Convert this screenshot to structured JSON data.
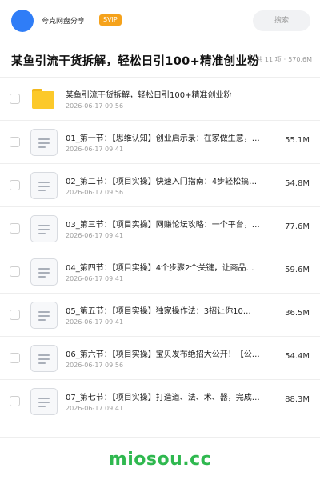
{
  "header": {
    "user_name": "夸克网盘分享",
    "badge": "SVIP",
    "search_placeholder": "搜索",
    "avatar_color": "#2f7df7",
    "badge_color": "#f5a21b"
  },
  "folder": {
    "title": "某鱼引流干货拆解，轻松日引100+精准创业粉",
    "meta_count": "共 11 项",
    "meta_separator": "·",
    "meta_size": "570.6M"
  },
  "items": [
    {
      "type": "folder",
      "icon": "folder-icon",
      "name": "某鱼引流干货拆解，轻松日引100+精准创业粉",
      "date": "2026-06-17 09:56",
      "size": ""
    },
    {
      "type": "file",
      "icon": "document-icon",
      "name": "01_第一节：【思维认知】创业启示录：在家做生意，…",
      "date": "2026-06-17 09:41",
      "size": "55.1M"
    },
    {
      "type": "file",
      "icon": "document-icon",
      "name": "02_第二节：【项目实操】快速入门指南：4步轻松搞…",
      "date": "2026-06-17 09:56",
      "size": "54.8M"
    },
    {
      "type": "file",
      "icon": "document-icon",
      "name": "03_第三节：【项目实操】网赚论坛攻略：一个平台，…",
      "date": "2026-06-17 09:41",
      "size": "77.6M"
    },
    {
      "type": "file",
      "icon": "document-icon",
      "name": "04_第四节：【项目实操】4个步骤2个关键，让商品…",
      "date": "2026-06-17 09:41",
      "size": "59.6M"
    },
    {
      "type": "file",
      "icon": "document-icon",
      "name": "05_第五节：【项目实操】独家操作法：3招让你10…",
      "date": "2026-06-17 09:41",
      "size": "36.5M"
    },
    {
      "type": "file",
      "icon": "document-icon",
      "name": "06_第六节：【项目实操】宝贝发布绝招大公开！【公…",
      "date": "2026-06-17 09:56",
      "size": "54.4M"
    },
    {
      "type": "file",
      "icon": "document-icon",
      "name": "07_第七节：【项目实操】打造道、法、术、器，完成…",
      "date": "2026-06-17 09:41",
      "size": "88.3M"
    }
  ],
  "watermark": {
    "text": "miosou.cc",
    "color": "#2fb84f"
  }
}
